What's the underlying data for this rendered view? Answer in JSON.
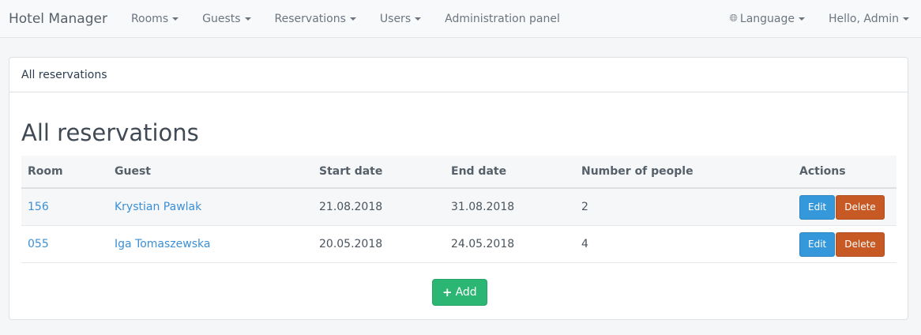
{
  "navbar": {
    "brand": "Hotel Manager",
    "items": [
      {
        "label": "Rooms"
      },
      {
        "label": "Guests"
      },
      {
        "label": "Reservations"
      },
      {
        "label": "Users"
      },
      {
        "label": "Administration panel"
      }
    ],
    "language_label": "Language",
    "user_label": "Hello, Admin"
  },
  "panel": {
    "heading": "All reservations",
    "title": "All reservations",
    "add_label": "Add"
  },
  "table": {
    "headers": [
      "Room",
      "Guest",
      "Start date",
      "End date",
      "Number of people",
      "Actions"
    ],
    "rows": [
      {
        "room": "156",
        "guest": "Krystian Pawlak",
        "start": "21.08.2018",
        "end": "31.08.2018",
        "people": "2"
      },
      {
        "room": "055",
        "guest": "Iga Tomaszewska",
        "start": "20.05.2018",
        "end": "24.05.2018",
        "people": "4"
      }
    ],
    "edit_label": "Edit",
    "delete_label": "Delete"
  }
}
